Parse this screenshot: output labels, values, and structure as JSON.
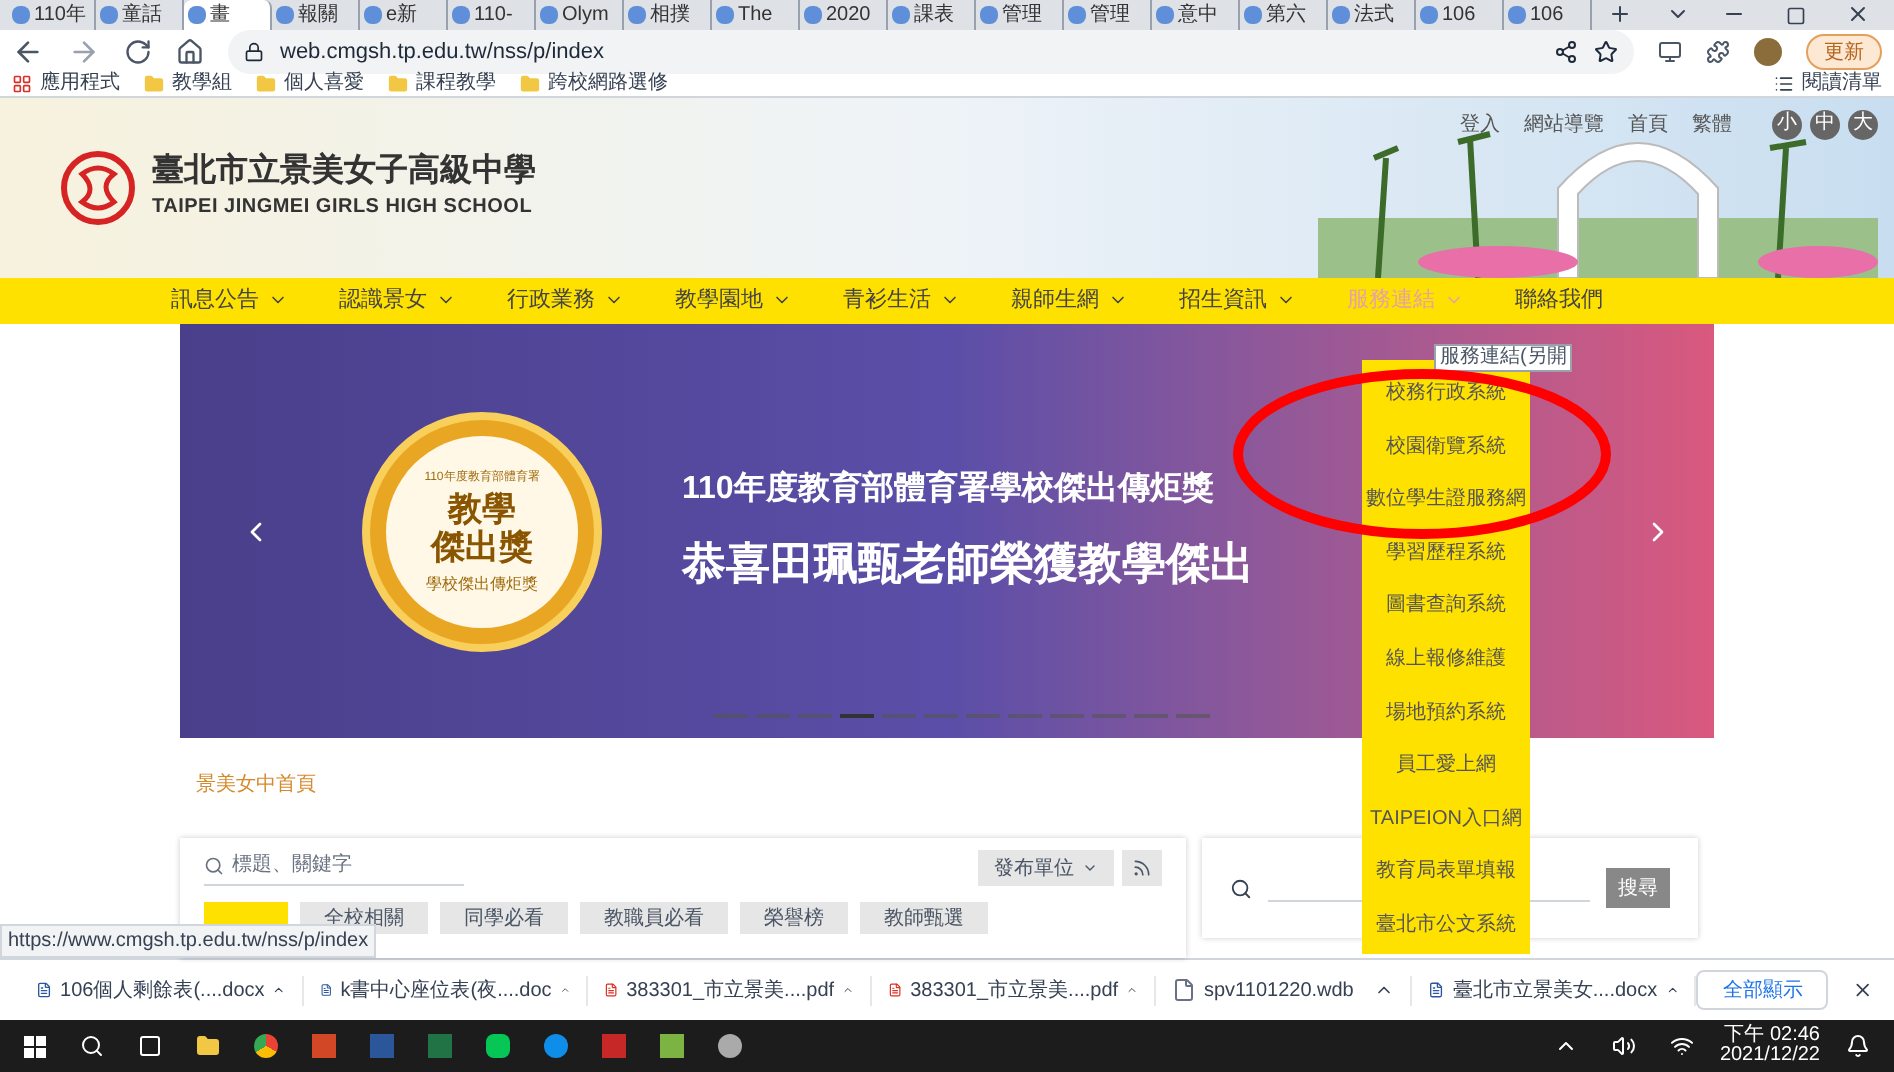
{
  "browser": {
    "tabs": [
      {
        "label": "110年",
        "selected": false
      },
      {
        "label": "童話",
        "selected": false
      },
      {
        "label": "畫",
        "selected": true
      },
      {
        "label": "報關",
        "selected": false
      },
      {
        "label": "e新",
        "selected": false
      },
      {
        "label": "110-",
        "selected": false
      },
      {
        "label": "Olym",
        "selected": false
      },
      {
        "label": "相撲",
        "selected": false
      },
      {
        "label": "The",
        "selected": false
      },
      {
        "label": "2020",
        "selected": false
      },
      {
        "label": "課表",
        "selected": false
      },
      {
        "label": "管理",
        "selected": false
      },
      {
        "label": "管理",
        "selected": false
      },
      {
        "label": "意中",
        "selected": false
      },
      {
        "label": "第六",
        "selected": false
      },
      {
        "label": "法式",
        "selected": false
      },
      {
        "label": "106",
        "selected": false
      },
      {
        "label": "106",
        "selected": false
      }
    ],
    "url": "web.cmgsh.tp.edu.tw/nss/p/index",
    "update_button": "更新",
    "bookmarks": [
      {
        "kind": "apps",
        "label": "應用程式"
      },
      {
        "kind": "folder",
        "label": "教學組"
      },
      {
        "kind": "folder",
        "label": "個人喜愛"
      },
      {
        "kind": "folder",
        "label": "課程教學"
      },
      {
        "kind": "folder",
        "label": "跨校網路選修"
      }
    ],
    "reading_list": "閱讀清單"
  },
  "site": {
    "school_name": "臺北市立景美女子高級中學",
    "school_name_en": "TAIPEI JINGMEI GIRLS HIGH SCHOOL",
    "top_links": [
      "登入",
      "網站導覽",
      "首頁",
      "繁體"
    ],
    "font_sizes": [
      "小",
      "中",
      "大"
    ],
    "nav": [
      {
        "label": "訊息公告",
        "active": false
      },
      {
        "label": "認識景女",
        "active": false
      },
      {
        "label": "行政業務",
        "active": false
      },
      {
        "label": "教學園地",
        "active": false
      },
      {
        "label": "青衫生活",
        "active": false
      },
      {
        "label": "親師生網",
        "active": false
      },
      {
        "label": "招生資訊",
        "active": false
      },
      {
        "label": "服務連結",
        "active": true
      },
      {
        "label": "聯絡我們",
        "active": false
      }
    ],
    "tooltip": "服務連結(另開",
    "dropdown": [
      "校務行政系統",
      "校園衛覽系統",
      "數位學生證服務網",
      "學習歷程系統",
      "圖書查詢系統",
      "線上報修維護",
      "場地預約系統",
      "員工愛上網",
      "TAIPEION入口網",
      "教育局表單填報",
      "臺北市公文系統"
    ],
    "banner": {
      "badge_top": "110年度教育部體育署",
      "badge_title_1": "教學",
      "badge_title_2": "傑出獎",
      "badge_bottom": "學校傑出傳炬獎",
      "headline": "110年度教育部體育署學校傑出傳炬獎",
      "title": "恭喜田珮甄老師榮獲教學傑出",
      "slides": [
        {
          "selected": false
        },
        {
          "selected": false
        },
        {
          "selected": false
        },
        {
          "selected": true
        },
        {
          "selected": false
        },
        {
          "selected": false
        },
        {
          "selected": false
        },
        {
          "selected": false
        },
        {
          "selected": false
        },
        {
          "selected": false
        },
        {
          "selected": false
        },
        {
          "selected": false
        }
      ]
    },
    "breadcrumb": "景美女中首頁",
    "news": {
      "search_placeholder": "標題、關鍵字",
      "unit_filter": "發布單位",
      "categories": [
        {
          "label": "全校相關",
          "selected": false
        },
        {
          "label": "同學必看",
          "selected": false
        },
        {
          "label": "教職員必看",
          "selected": false
        },
        {
          "label": "榮譽榜",
          "selected": false
        },
        {
          "label": "教師甄選",
          "selected": false
        }
      ]
    },
    "site_search": {
      "button": "搜尋"
    },
    "status_url": "https://www.cmgsh.tp.edu.tw/nss/p/index"
  },
  "downloads": {
    "items": [
      {
        "kind": "word",
        "name": "106個人剩餘表(....docx"
      },
      {
        "kind": "word",
        "name": "k書中心座位表(夜....doc"
      },
      {
        "kind": "pdf",
        "name": "383301_市立景美....pdf"
      },
      {
        "kind": "pdf",
        "name": "383301_市立景美....pdf"
      },
      {
        "kind": "file",
        "name": "spv1101220.wdb"
      },
      {
        "kind": "word",
        "name": "臺北市立景美女....docx"
      }
    ],
    "show_all": "全部顯示"
  },
  "taskbar": {
    "time": "下午 02:46",
    "date": "2021/12/22"
  }
}
